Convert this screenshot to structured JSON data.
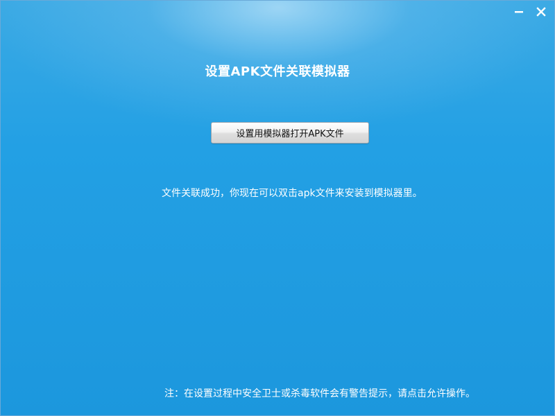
{
  "window": {
    "controls": {
      "minimize_icon": "minimize-icon",
      "close_icon": "close-icon"
    }
  },
  "dialog": {
    "title": "设置APK文件关联模拟器",
    "button_label": "设置用模拟器打开APK文件",
    "status_message": "文件关联成功，你现在可以双击apk文件来安装到模拟器里。",
    "footer_note": "注：在设置过程中安全卫士或杀毒软件会有警告提示，请点击允许操作。"
  },
  "colors": {
    "background": "#23a0e4",
    "text": "#ffffff",
    "button_text": "#111111"
  }
}
